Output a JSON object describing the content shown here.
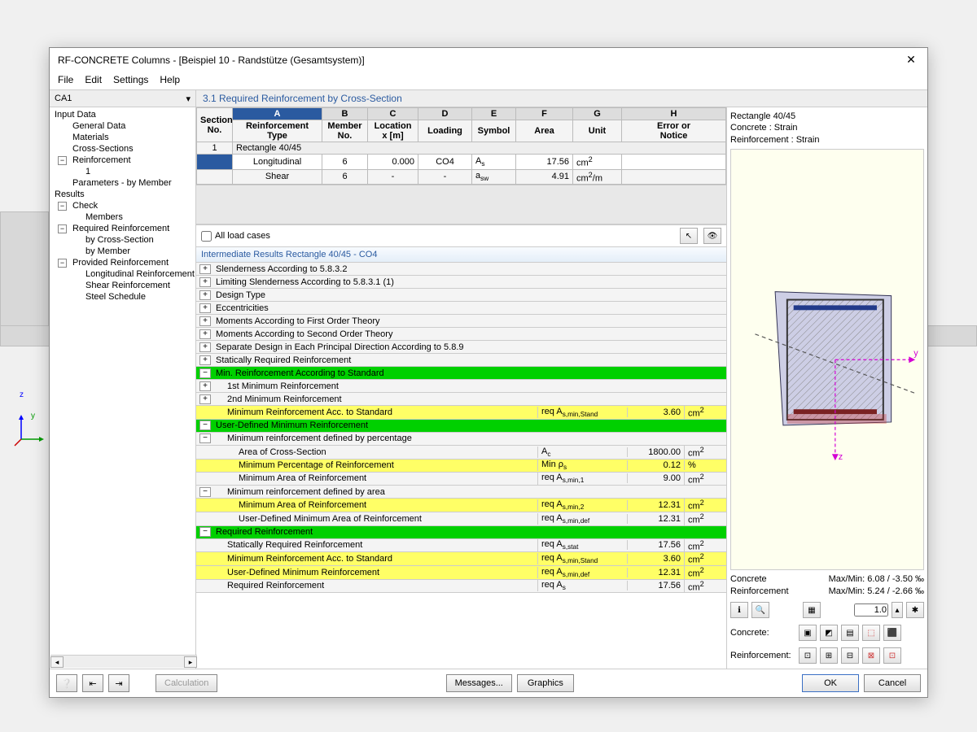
{
  "window": {
    "title": "RF-CONCRETE Columns - [Beispiel 10 - Randstütze (Gesamtsystem)]"
  },
  "menu": {
    "file": "File",
    "edit": "Edit",
    "settings": "Settings",
    "help": "Help"
  },
  "case": {
    "value": "CA1"
  },
  "section_title": "3.1 Required Reinforcement by Cross-Section",
  "tree": {
    "input_data": "Input Data",
    "general_data": "General Data",
    "materials": "Materials",
    "cross_sections": "Cross-Sections",
    "reinforcement": "Reinforcement",
    "reinf_1": "1",
    "params_by_member": "Parameters - by Member",
    "results": "Results",
    "check": "Check",
    "members": "Members",
    "req_reinf": "Required Reinforcement",
    "by_cross_section": "by Cross-Section",
    "by_member": "by Member",
    "prov_reinf": "Provided Reinforcement",
    "long_reinf": "Longitudinal Reinforcement",
    "shear_reinf": "Shear Reinforcement",
    "steel_schedule": "Steel Schedule"
  },
  "grid": {
    "letters": [
      "A",
      "B",
      "C",
      "D",
      "E",
      "F",
      "G",
      "H"
    ],
    "headers": {
      "section_no": "Section\nNo.",
      "reinf_type": "Reinforcement\nType",
      "member_no": "Member\nNo.",
      "location_x": "Location\nx [m]",
      "loading": "Loading",
      "reinforcement": "Reinforcement",
      "symbol": "Symbol",
      "area": "Area",
      "unit": "Unit",
      "error": "Error or\nNotice"
    },
    "section_label": "Rectangle 40/45",
    "rows": [
      {
        "sec": "1",
        "type": "Longitudinal",
        "member": "6",
        "x": "0.000",
        "load": "CO4",
        "sym": "A<sub>s</sub>",
        "area": "17.56",
        "unit": "cm<sup>2</sup>"
      },
      {
        "sec": "",
        "type": "Shear",
        "member": "6",
        "x": "-",
        "load": "-",
        "sym": "a<sub>sw</sub>",
        "area": "4.91",
        "unit": "cm<sup>2</sup>/m"
      }
    ]
  },
  "options": {
    "all_load_cases": "All load cases"
  },
  "intermediate": {
    "header": "Intermediate Results Rectangle 40/45 - CO4",
    "rows": [
      {
        "cls": "plain",
        "tog": "+",
        "lab": "Slenderness According to 5.8.3.2"
      },
      {
        "cls": "plain",
        "tog": "+",
        "lab": "Limiting Slenderness According to 5.8.3.1 (1)"
      },
      {
        "cls": "plain",
        "tog": "+",
        "lab": "Design Type"
      },
      {
        "cls": "plain",
        "tog": "+",
        "lab": "Eccentricities"
      },
      {
        "cls": "plain",
        "tog": "+",
        "lab": "Moments According to First Order Theory"
      },
      {
        "cls": "plain",
        "tog": "+",
        "lab": "Moments According to Second Order Theory"
      },
      {
        "cls": "plain",
        "tog": "+",
        "lab": "Separate Design in Each Principal Direction According to 5.8.9"
      },
      {
        "cls": "plain",
        "tog": "+",
        "lab": "Statically Required Reinforcement"
      },
      {
        "cls": "green",
        "tog": "−",
        "lab": "Min. Reinforcement According to Standard"
      },
      {
        "cls": "plain indent1",
        "tog": "+",
        "lab": "1st Minimum Reinforcement"
      },
      {
        "cls": "plain indent1",
        "tog": "+",
        "lab": "2nd Minimum Reinforcement"
      },
      {
        "cls": "yellow indent1",
        "lab": "Minimum Reinforcement Acc. to Standard",
        "sym": "req A<sub>s,min,Stand</sub>",
        "val": "3.60",
        "unit": "cm<sup>2</sup>"
      },
      {
        "cls": "green",
        "tog": "−",
        "lab": "User-Defined Minimum Reinforcement"
      },
      {
        "cls": "plain indent1",
        "tog": "−",
        "lab": "Minimum reinforcement defined by percentage"
      },
      {
        "cls": "plain indent2",
        "lab": "Area of Cross-Section",
        "sym": "A<sub>c</sub>",
        "val": "1800.00",
        "unit": "cm<sup>2</sup>"
      },
      {
        "cls": "yellow indent2",
        "lab": "Minimum Percentage of Reinforcement",
        "sym": "Min ρ<sub>s</sub>",
        "val": "0.12",
        "unit": "%"
      },
      {
        "cls": "plain indent2",
        "lab": "Minimum Area of Reinforcement",
        "sym": "req A<sub>s,min,1</sub>",
        "val": "9.00",
        "unit": "cm<sup>2</sup>"
      },
      {
        "cls": "plain indent1",
        "tog": "−",
        "lab": "Minimum reinforcement defined by area"
      },
      {
        "cls": "yellow indent2",
        "lab": "Minimum Area of Reinforcement",
        "sym": "req A<sub>s,min,2</sub>",
        "val": "12.31",
        "unit": "cm<sup>2</sup>"
      },
      {
        "cls": "plain indent2",
        "lab": "User-Defined Minimum Area of Reinforcement",
        "sym": "req A<sub>s,min,def</sub>",
        "val": "12.31",
        "unit": "cm<sup>2</sup>"
      },
      {
        "cls": "green",
        "tog": "−",
        "lab": "Required Reinforcement"
      },
      {
        "cls": "plain indent1",
        "lab": "Statically Required Reinforcement",
        "sym": "req A<sub>s,stat</sub>",
        "val": "17.56",
        "unit": "cm<sup>2</sup>"
      },
      {
        "cls": "yellow indent1",
        "lab": "Minimum Reinforcement Acc. to Standard",
        "sym": "req A<sub>s,min,Stand</sub>",
        "val": "3.60",
        "unit": "cm<sup>2</sup>"
      },
      {
        "cls": "yellow indent1",
        "lab": "User-Defined Minimum Reinforcement",
        "sym": "req A<sub>s,min,def</sub>",
        "val": "12.31",
        "unit": "cm<sup>2</sup>"
      },
      {
        "cls": "plain indent1",
        "lab": "Required Reinforcement",
        "sym": "req A<sub>s</sub>",
        "val": "17.56",
        "unit": "cm<sup>2</sup>"
      }
    ]
  },
  "right": {
    "line1": "Rectangle 40/45",
    "line2": "Concrete : Strain",
    "line3": "Reinforcement : Strain",
    "concrete_mm": "Max/Min: 6.08 / -3.50 ‰",
    "reinf_mm": "Max/Min: 5.24 / -2.66 ‰",
    "concrete_lbl": "Concrete",
    "reinf_lbl": "Reinforcement",
    "concrete_row": "Concrete:",
    "reinf_row": "Reinforcement:",
    "scale": "1.0"
  },
  "buttons": {
    "calc": "Calculation",
    "messages": "Messages...",
    "graphics": "Graphics",
    "ok": "OK",
    "cancel": "Cancel"
  }
}
